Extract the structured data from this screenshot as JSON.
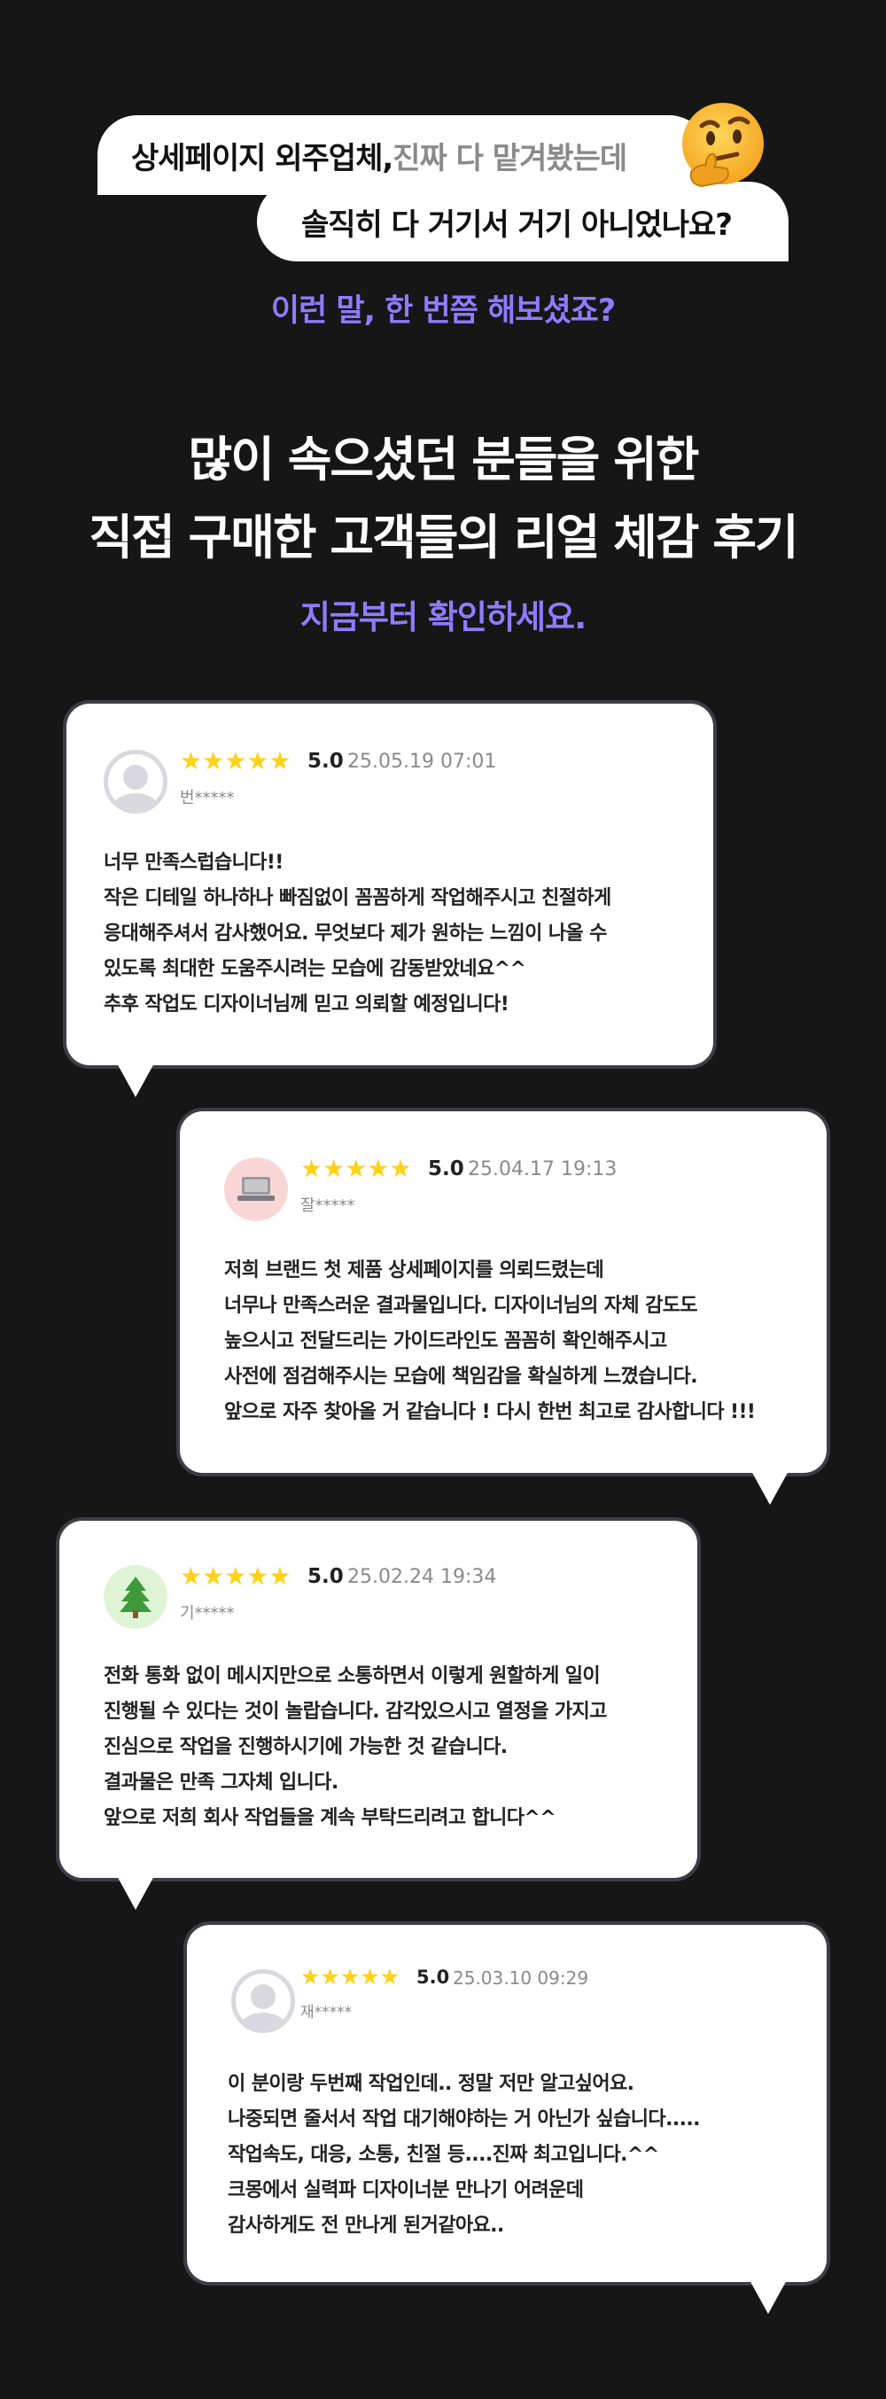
{
  "intro": {
    "bubble_one_prefix": "상세페이지 외주업체,",
    "bubble_one_muted": " 진짜 다 맡겨봤는데",
    "bubble_two": "솔직히 다 거기서 거기 아니었나요?",
    "emoji": "🤔",
    "question": "이런 말, 한 번쯤 해보셨죠?"
  },
  "headline": {
    "line1": "많이 속으셨던 분들을 위한",
    "line2": "직접 구매한 고객들의 리얼 체감 후기",
    "sub": "지금부터 확인하세요."
  },
  "colors": {
    "background": "#161616",
    "accent": "#8f7bff",
    "star": "#ffd21a"
  },
  "reviews": [
    {
      "stars": "★★★★★",
      "score": "5.0",
      "date": "25.05.19 07:01",
      "user": "번*****",
      "avatar": "default-avatar-icon",
      "lines": [
        "너무 만족스럽습니다!!",
        "작은 디테일 하나하나 빠짐없이 꼼꼼하게 작업해주시고 친절하게",
        "응대해주셔서 감사했어요. 무엇보다 제가 원하는 느낌이 나올 수",
        "있도록 최대한 도움주시려는 모습에 감동받았네요^^",
        "추후 작업도 디자이너님께 믿고 의뢰할 예정입니다!"
      ]
    },
    {
      "stars": "★★★★★",
      "score": "5.0",
      "date": "25.04.17 19:13",
      "user": "잘*****",
      "avatar": "laptop-avatar-icon",
      "lines": [
        "저희 브랜드 첫 제품 상세페이지를 의뢰드렸는데",
        "너무나 만족스러운 결과물입니다. 디자이너님의 자체 감도도",
        "높으시고 전달드리는 가이드라인도 꼼꼼히 확인해주시고",
        "사전에 점검해주시는 모습에 책임감을 확실하게 느꼈습니다.",
        "앞으로 자주 찾아올 거 같습니다 ! 다시 한번 최고로 감사합니다 !!!"
      ]
    },
    {
      "stars": "★★★★★",
      "score": "5.0",
      "date": "25.02.24 19:34",
      "user": "기*****",
      "avatar": "tree-avatar-icon",
      "lines": [
        "전화 통화 없이 메시지만으로 소통하면서 이렇게 원할하게 일이",
        "진행될 수 있다는 것이 놀랍습니다. 감각있으시고 열정을 가지고",
        "진심으로 작업을 진행하시기에 가능한 것 같습니다.",
        "결과물은 만족 그자체 입니다.",
        "앞으로 저희 회사 작업들을 계속 부탁드리려고 합니다^^"
      ]
    },
    {
      "stars": "★★★★★",
      "score": "5.0",
      "date": "25.03.10 09:29",
      "user": "재*****",
      "avatar": "default-avatar-icon",
      "lines": [
        "이 분이랑 두번째 작업인데.. 정말 저만 알고싶어요.",
        "나중되면 줄서서 작업 대기해야하는 거 아닌가 싶습니다.....",
        "작업속도, 대응, 소통, 친절 등....진짜 최고입니다.^^",
        "크몽에서 실력파 디자이너분 만나기 어려운데",
        "감사하게도 전 만나게 된거같아요.."
      ]
    }
  ]
}
